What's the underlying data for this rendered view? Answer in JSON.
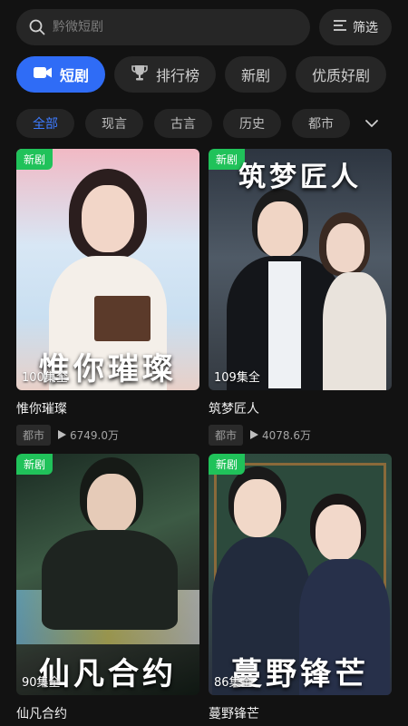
{
  "search": {
    "placeholder": "黔微短剧"
  },
  "filter": {
    "label": "筛选"
  },
  "tabs": [
    {
      "label": "短剧",
      "icon": "video-camera-icon",
      "active": true
    },
    {
      "label": "排行榜",
      "icon": "trophy-icon"
    },
    {
      "label": "新剧"
    },
    {
      "label": "优质好剧"
    }
  ],
  "genres": [
    {
      "label": "全部",
      "active": true
    },
    {
      "label": "现言"
    },
    {
      "label": "古言"
    },
    {
      "label": "历史"
    },
    {
      "label": "都市"
    }
  ],
  "colors": {
    "accent": "#2f6cf6",
    "new_badge": "#20c25a",
    "background": "#121212"
  },
  "dramas": [
    {
      "badge": "新剧",
      "episodes": "100集全",
      "poster_text": "惟你璀璨",
      "title": "惟你璀璨",
      "tag": "都市",
      "plays": "6749.0万"
    },
    {
      "badge": "新剧",
      "episodes": "109集全",
      "poster_text": "筑梦匠人",
      "title": "筑梦匠人",
      "tag": "都市",
      "plays": "4078.6万"
    },
    {
      "badge": "新剧",
      "episodes": "90集全",
      "poster_text": "仙凡合约",
      "title": "仙凡合约",
      "tag": "",
      "plays": ""
    },
    {
      "badge": "新剧",
      "episodes": "86集全",
      "poster_text": "蔓野锋芒",
      "title": "蔓野锋芒",
      "tag": "",
      "plays": ""
    }
  ]
}
